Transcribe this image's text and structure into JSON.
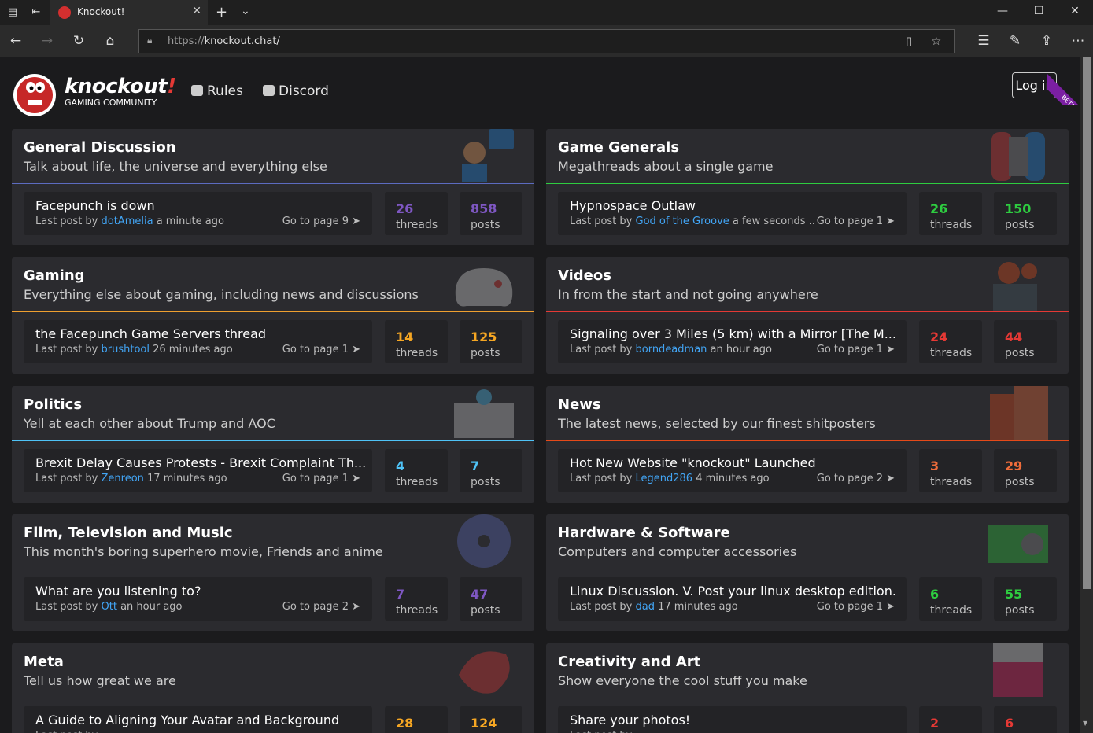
{
  "browser": {
    "tab_title": "Knockout!",
    "url_proto": "https://",
    "url_host": "knockout.chat/"
  },
  "header": {
    "brand": "knockout",
    "brand_bang": "!",
    "brand_sub": "GAMING COMMUNITY",
    "rules_label": "Rules",
    "discord_label": "Discord",
    "login_label": "Log in",
    "beta_label": "BETA"
  },
  "subforums": [
    {
      "title": "General Discussion",
      "desc": "Talk about life, the universe and everything else",
      "accent": "#5c6bc0",
      "thread": "Facepunch is down",
      "last_by_prefix": "Last post by ",
      "user": "dotAmelia",
      "when": " a minute ago",
      "goto": "Go to page 9 ➤",
      "threads": "26",
      "posts": "858",
      "num_color": "#7e57c2"
    },
    {
      "title": "Game Generals",
      "desc": "Megathreads about a single game",
      "accent": "#2ecc40",
      "thread": "Hypnospace Outlaw",
      "last_by_prefix": "Last post by ",
      "user": "God of the Groove",
      "when": " a few seconds ...",
      "goto": "Go to page 1 ➤",
      "threads": "26",
      "posts": "150",
      "num_color": "#2ecc40"
    },
    {
      "title": "Gaming",
      "desc": "Everything else about gaming, including news and discussions",
      "accent": "#f0a030",
      "thread": "the Facepunch Game Servers thread",
      "last_by_prefix": "Last post by ",
      "user": "brushtool",
      "when": " 26 minutes ago",
      "goto": "Go to page 1 ➤",
      "threads": "14",
      "posts": "125",
      "num_color": "#f5a623"
    },
    {
      "title": "Videos",
      "desc": "In from the start and not going anywhere",
      "accent": "#e53935",
      "thread": "Signaling over 3 Miles (5 km) with a Mirror [The M...",
      "last_by_prefix": "Last post by ",
      "user": "borndeadman",
      "when": " an hour ago",
      "goto": "Go to page 1 ➤",
      "threads": "24",
      "posts": "44",
      "num_color": "#e53935"
    },
    {
      "title": "Politics",
      "desc": "Yell at each other about Trump and AOC",
      "accent": "#4fc3f7",
      "thread": "Brexit Delay Causes Protests - Brexit Complaint Th...",
      "last_by_prefix": "Last post by ",
      "user": "Zenreon",
      "when": " 17 minutes ago",
      "goto": "Go to page 1 ➤",
      "threads": "4",
      "posts": "7",
      "num_color": "#4fc3f7"
    },
    {
      "title": "News",
      "desc": "The latest news, selected by our finest shitposters",
      "accent": "#e64a19",
      "thread": "Hot New Website \"knockout\" Launched",
      "last_by_prefix": "Last post by ",
      "user": "Legend286",
      "when": " 4 minutes ago",
      "goto": "Go to page 2 ➤",
      "threads": "3",
      "posts": "29",
      "num_color": "#ef6c3a"
    },
    {
      "title": "Film, Television and Music",
      "desc": "This month's boring superhero movie, Friends and anime",
      "accent": "#5c6bc0",
      "thread": "What are you listening to?",
      "last_by_prefix": "Last post by ",
      "user": "Ott",
      "when": " an hour ago",
      "goto": "Go to page 2 ➤",
      "threads": "7",
      "posts": "47",
      "num_color": "#7e57c2"
    },
    {
      "title": "Hardware & Software",
      "desc": "Computers and computer accessories",
      "accent": "#2ecc40",
      "thread": "Linux Discussion. V. Post your linux desktop edition.",
      "last_by_prefix": "Last post by ",
      "user": "dad",
      "when": " 17 minutes ago",
      "goto": "Go to page 1 ➤",
      "threads": "6",
      "posts": "55",
      "num_color": "#2ecc40"
    },
    {
      "title": "Meta",
      "desc": "Tell us how great we are",
      "accent": "#f0a030",
      "thread": "A Guide to Aligning Your Avatar and Background",
      "last_by_prefix": "Last post by ",
      "user": "",
      "when": "",
      "goto": "",
      "threads": "28",
      "posts": "124",
      "num_color": "#f5a623"
    },
    {
      "title": "Creativity and Art",
      "desc": "Show everyone the cool stuff you make",
      "accent": "#e53935",
      "thread": "Share your photos!",
      "last_by_prefix": "Last post by ",
      "user": "",
      "when": "",
      "goto": "",
      "threads": "2",
      "posts": "6",
      "num_color": "#e53935"
    }
  ],
  "labels": {
    "threads": "threads",
    "posts": "posts"
  }
}
